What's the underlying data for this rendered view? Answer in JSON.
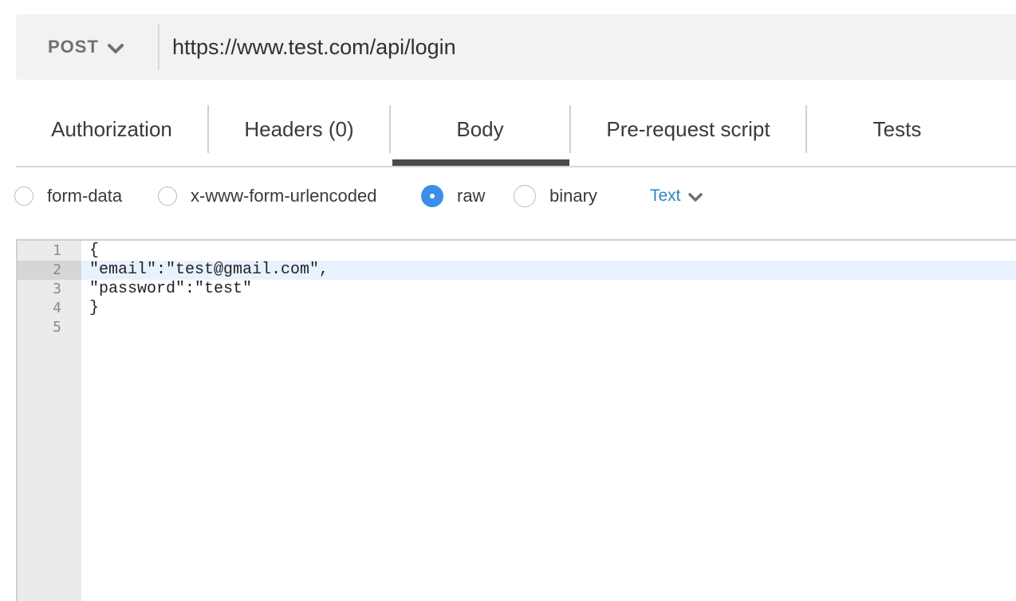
{
  "request": {
    "method": "POST",
    "url": "https://www.test.com/api/login"
  },
  "tabs": [
    {
      "label": "Authorization",
      "active": false
    },
    {
      "label": "Headers (0)",
      "active": false
    },
    {
      "label": "Body",
      "active": true
    },
    {
      "label": "Pre-request script",
      "active": false
    },
    {
      "label": "Tests",
      "active": false
    }
  ],
  "body_modes": [
    {
      "label": "form-data",
      "selected": false
    },
    {
      "label": "x-www-form-urlencoded",
      "selected": false
    },
    {
      "label": "raw",
      "selected": true
    },
    {
      "label": "binary",
      "selected": false
    }
  ],
  "format": {
    "selected": "Text"
  },
  "editor": {
    "active_line": 2,
    "lines": [
      {
        "num": "1",
        "code": "{"
      },
      {
        "num": "2",
        "code": "\"email\":\"test@gmail.com\","
      },
      {
        "num": "3",
        "code": "\"password\":\"test\""
      },
      {
        "num": "4",
        "code": "}"
      },
      {
        "num": "5",
        "code": ""
      }
    ]
  },
  "colors": {
    "accent_blue": "#3b8fe8",
    "link_blue": "#2a88c8",
    "tab_underline": "#4a4a4a",
    "active_line": "#e8f2fe"
  }
}
